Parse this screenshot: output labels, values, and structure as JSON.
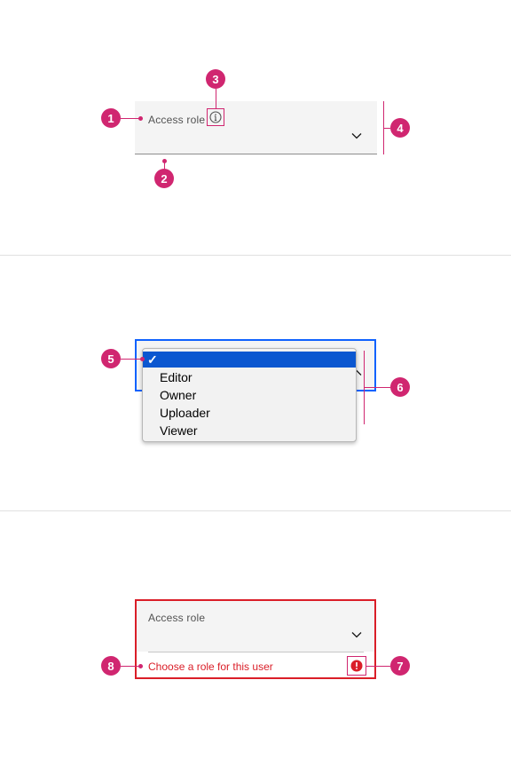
{
  "colors": {
    "callout": "#d02670",
    "field_bg": "#f4f4f4",
    "focus": "#0f62fe",
    "error": "#da1e28"
  },
  "section1": {
    "label": "Access role",
    "icons": [
      "info-icon",
      "chevron-down-icon"
    ],
    "callouts": [
      "1",
      "2",
      "3",
      "4"
    ]
  },
  "section2": {
    "selected_mark": "✓",
    "options": [
      "Editor",
      "Owner",
      "Uploader",
      "Viewer"
    ],
    "callouts": [
      "5",
      "6"
    ]
  },
  "section3": {
    "label": "Access role",
    "error_message": "Choose a role for this user",
    "icons": [
      "chevron-down-icon",
      "warning-filled-icon"
    ],
    "callouts": [
      "7",
      "8"
    ]
  }
}
